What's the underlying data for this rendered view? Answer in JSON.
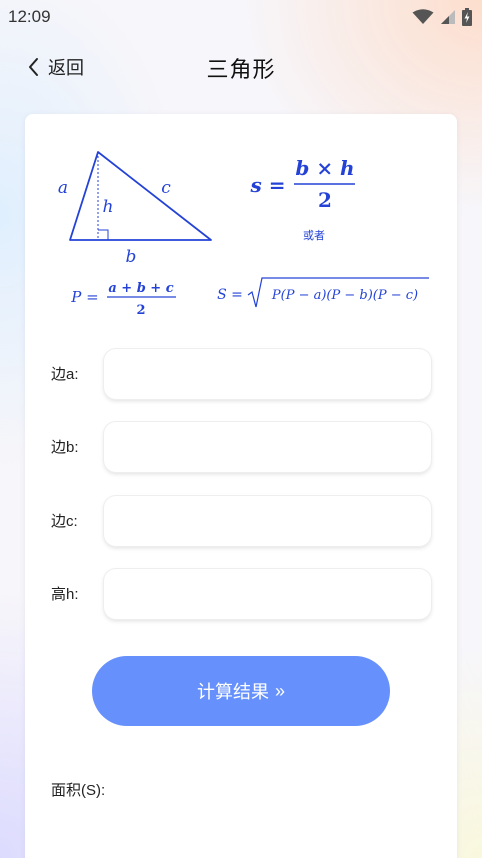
{
  "status": {
    "time": "12:09"
  },
  "nav": {
    "back_label": "返回",
    "title": "三角形"
  },
  "figure": {
    "label_a": "a",
    "label_b": "b",
    "label_c": "c",
    "label_h": "h",
    "label_or": "或者",
    "formula_s": {
      "lhs": "s =",
      "numerator": "b × h",
      "denominator": "2"
    },
    "formula_p": {
      "lhs": "P =",
      "numerator": "a + b + c",
      "denominator": "2"
    },
    "formula_heron": {
      "lhs": "S =",
      "radicand": "P(P − a)(P − b)(P − c)"
    }
  },
  "fields": [
    {
      "label": "边a:",
      "value": ""
    },
    {
      "label": "边b:",
      "value": ""
    },
    {
      "label": "边c:",
      "value": ""
    },
    {
      "label": "高h:",
      "value": ""
    }
  ],
  "calc_button": {
    "label": "计算结果",
    "icon": "»"
  },
  "result": {
    "label": "面积(S):"
  },
  "colors": {
    "accent": "#6690fb",
    "formula": "#2443d6"
  }
}
